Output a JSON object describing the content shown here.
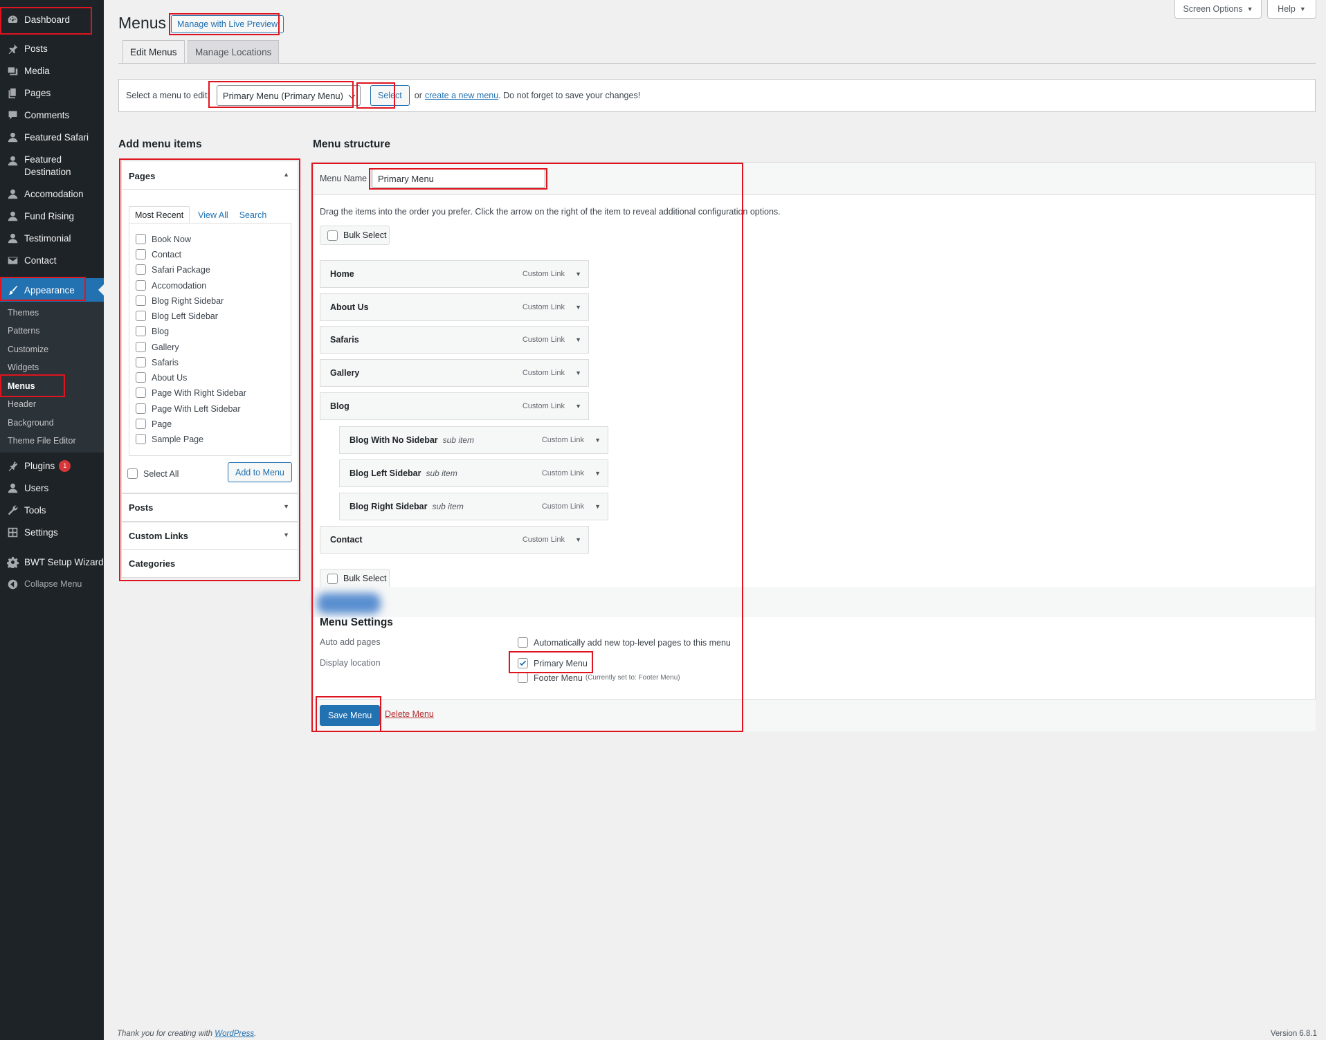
{
  "sidebar": {
    "items": [
      {
        "label": "Dashboard",
        "icon": "dashboard-icon"
      },
      {
        "label": "Posts",
        "icon": "pin-icon"
      },
      {
        "label": "Media",
        "icon": "media-icon"
      },
      {
        "label": "Pages",
        "icon": "pages-icon"
      },
      {
        "label": "Comments",
        "icon": "comment-icon"
      },
      {
        "label": "Featured Safari",
        "icon": "user-icon"
      },
      {
        "label": "Featured Destination",
        "icon": "user-icon"
      },
      {
        "label": "Accomodation",
        "icon": "user-icon"
      },
      {
        "label": "Fund Rising",
        "icon": "user-icon"
      },
      {
        "label": "Testimonial",
        "icon": "user-icon"
      },
      {
        "label": "Contact",
        "icon": "envelope-icon"
      },
      {
        "label": "Appearance",
        "icon": "brush-icon"
      }
    ],
    "appearance_submenu": [
      "Themes",
      "Patterns",
      "Customize",
      "Widgets",
      "Menus",
      "Header",
      "Background",
      "Theme File Editor"
    ],
    "lower_items": [
      {
        "label": "Plugins",
        "icon": "plugin-icon",
        "badge": "1"
      },
      {
        "label": "Users",
        "icon": "user-icon"
      },
      {
        "label": "Tools",
        "icon": "wrench-icon"
      },
      {
        "label": "Settings",
        "icon": "settings-icon"
      },
      {
        "label": "BWT Setup Wizard",
        "icon": "gear-icon"
      }
    ],
    "collapse_label": "Collapse Menu"
  },
  "header": {
    "screen_options": "Screen Options",
    "help": "Help",
    "title": "Menus",
    "live_preview": "Manage with Live Preview"
  },
  "tabs": [
    "Edit Menus",
    "Manage Locations"
  ],
  "select_bar": {
    "label": "Select a menu to edit:",
    "selected": "Primary Menu (Primary Menu)",
    "select_button": "Select",
    "or_text": "or",
    "create_link": "create a new menu",
    "suffix": ". Do not forget to save your changes!"
  },
  "add_items": {
    "heading": "Add menu items",
    "pages_title": "Pages",
    "tabs": [
      "Most Recent",
      "View All",
      "Search"
    ],
    "pages": [
      "Book Now",
      "Contact",
      "Safari Package",
      "Accomodation",
      "Blog Right Sidebar",
      "Blog Left Sidebar",
      "Blog",
      "Gallery",
      "Safaris",
      "About Us",
      "Page With Right Sidebar",
      "Page With Left Sidebar",
      "Page",
      "Sample Page"
    ],
    "select_all": "Select All",
    "add_button": "Add to Menu",
    "sections": [
      "Posts",
      "Custom Links",
      "Categories"
    ]
  },
  "structure": {
    "heading": "Menu structure",
    "menu_name_label": "Menu Name",
    "menu_name_value": "Primary Menu",
    "instructions": "Drag the items into the order you prefer. Click the arrow on the right of the item to reveal additional configuration options.",
    "bulk_select": "Bulk Select",
    "items": [
      {
        "name": "Home",
        "type": "Custom Link",
        "sub": ""
      },
      {
        "name": "About Us",
        "type": "Custom Link",
        "sub": ""
      },
      {
        "name": "Safaris",
        "type": "Custom Link",
        "sub": ""
      },
      {
        "name": "Gallery",
        "type": "Custom Link",
        "sub": ""
      },
      {
        "name": "Blog",
        "type": "Custom Link",
        "sub": ""
      },
      {
        "name": "Blog With No Sidebar",
        "type": "Custom Link",
        "sub": "sub item"
      },
      {
        "name": "Blog Left Sidebar",
        "type": "Custom Link",
        "sub": "sub item"
      },
      {
        "name": "Blog Right Sidebar",
        "type": "Custom Link",
        "sub": "sub item"
      },
      {
        "name": "Contact",
        "type": "Custom Link",
        "sub": ""
      }
    ]
  },
  "settings": {
    "heading": "Menu Settings",
    "auto_add_label": "Auto add pages",
    "auto_add_option": "Automatically add new top-level pages to this menu",
    "display_location_label": "Display location",
    "primary_option": "Primary Menu",
    "footer_option": "Footer Menu",
    "footer_note": "(Currently set to: Footer Menu)",
    "primary_checked": true
  },
  "actions": {
    "save": "Save Menu",
    "delete": "Delete Menu"
  },
  "footer": {
    "thanks_prefix": "Thank you for creating with",
    "thanks_link": "WordPress",
    "thanks_suffix": ".",
    "version": "Version 6.8.1"
  },
  "colors": {
    "admin_bg": "#1d2327",
    "accent": "#2271b1",
    "annotation": "#e0141e"
  }
}
